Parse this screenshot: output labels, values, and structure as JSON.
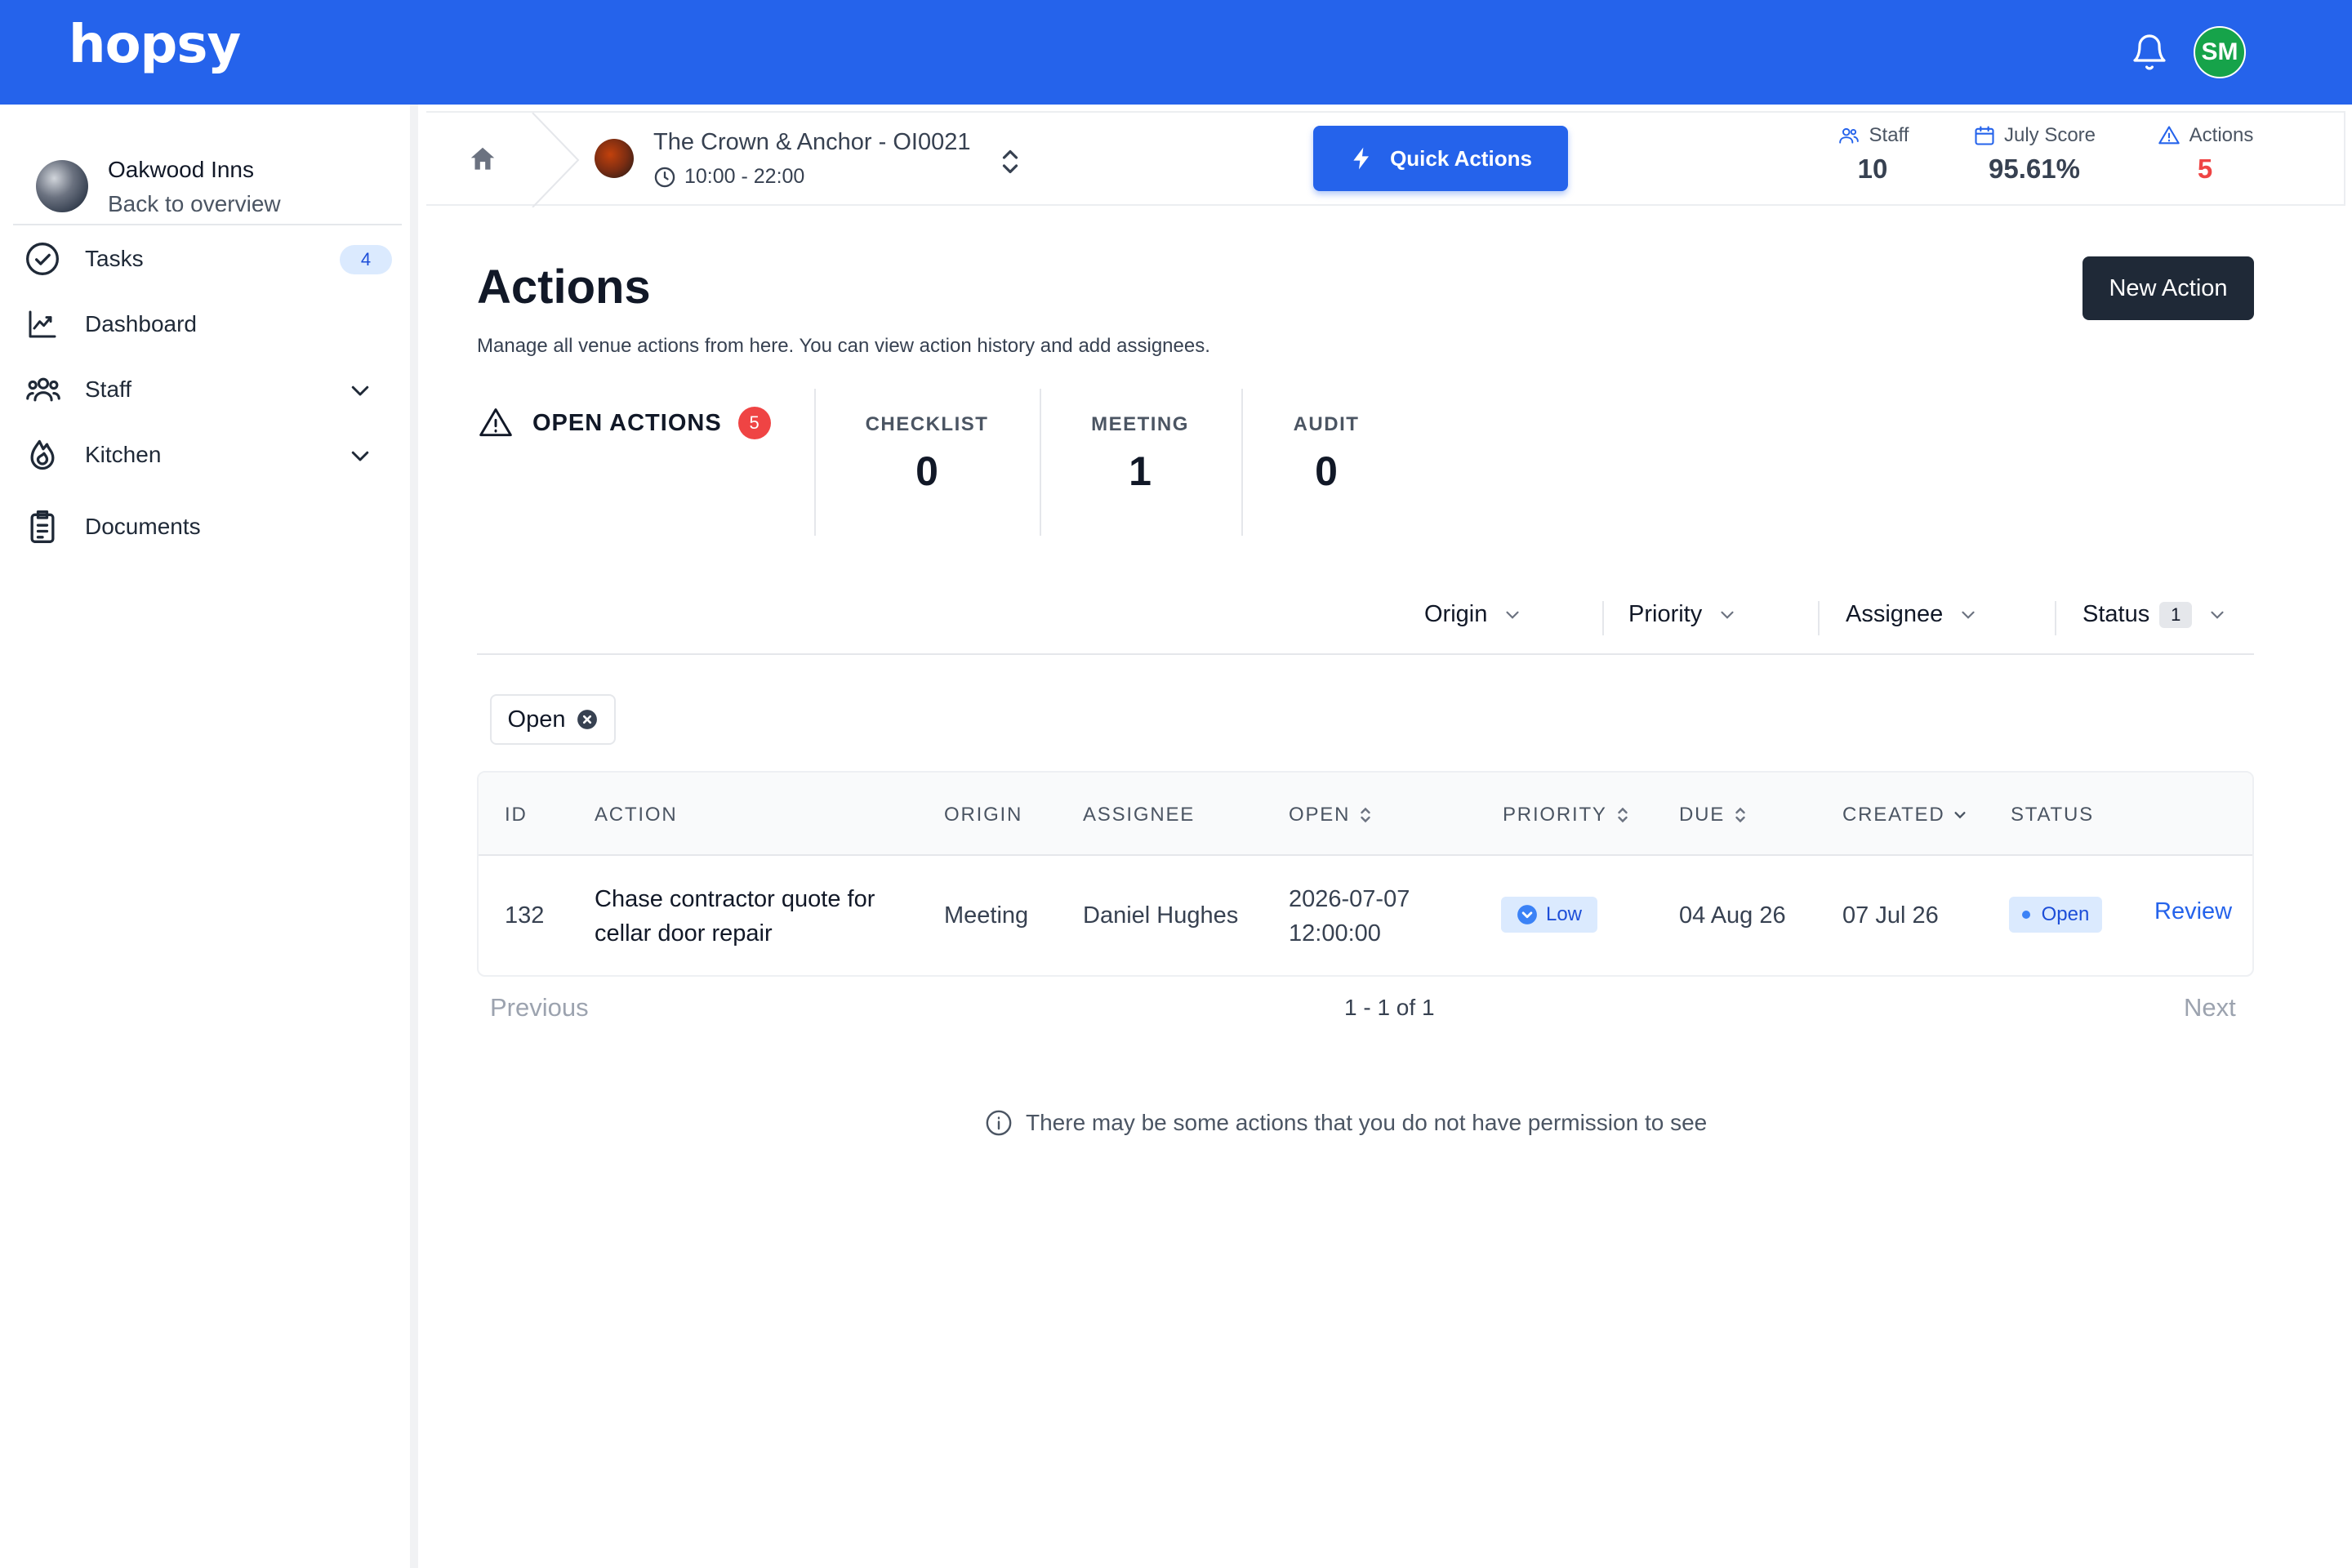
{
  "app": {
    "logo_text": "hopsy",
    "user_initials": "SM"
  },
  "sidebar": {
    "org_name": "Oakwood Inns",
    "org_back": "Back to overview",
    "items": [
      {
        "label": "Tasks",
        "icon": "check-circle-icon",
        "badge": "4"
      },
      {
        "label": "Dashboard",
        "icon": "chart-line-icon"
      },
      {
        "label": "Staff",
        "icon": "users-icon"
      },
      {
        "label": "Kitchen",
        "icon": "fire-icon"
      },
      {
        "label": "Documents",
        "icon": "clipboard-icon"
      }
    ]
  },
  "venue": {
    "name": "The Crown & Anchor - OI0021",
    "hours": "10:00 - 22:00"
  },
  "quick_actions_label": "Quick Actions",
  "stats": [
    {
      "label": "Staff",
      "value": "10",
      "icon": "users-icon"
    },
    {
      "label": "July Score",
      "value": "95.61%",
      "icon": "calendar-icon"
    },
    {
      "label": "Actions",
      "value": "5",
      "icon": "warning-icon",
      "value_color": "#ef4444"
    }
  ],
  "page": {
    "title": "Actions",
    "description": "Manage all venue actions from here. You can view action history and add assignees.",
    "new_action_label": "New Action"
  },
  "summary": {
    "open_actions_label": "OPEN ACTIONS",
    "open_actions_count": "5",
    "counts": [
      {
        "label": "CHECKLIST",
        "value": "0"
      },
      {
        "label": "MEETING",
        "value": "1"
      },
      {
        "label": "AUDIT",
        "value": "0"
      }
    ]
  },
  "filters": {
    "origin": "Origin",
    "priority": "Priority",
    "assignee": "Assignee",
    "status": "Status",
    "status_count": "1",
    "active_chip": "Open"
  },
  "table": {
    "columns": [
      "ID",
      "ACTION",
      "ORIGIN",
      "ASSIGNEE",
      "OPEN",
      "PRIORITY",
      "DUE",
      "CREATED",
      "STATUS"
    ],
    "rows": [
      {
        "id": "132",
        "action_line1": "Chase contractor quote for",
        "action_line2": "cellar door repair",
        "origin": "Meeting",
        "assignee": "Daniel Hughes",
        "open_date": "2026-07-07",
        "open_time": "12:00:00",
        "priority": "Low",
        "due": "04 Aug 26",
        "created": "07 Jul 26",
        "status": "Open",
        "review": "Review"
      }
    ]
  },
  "pagination": {
    "previous": "Previous",
    "info": "1 - 1 of 1",
    "next": "Next"
  },
  "permission_note": "There may be some actions that you do not have permission to see",
  "colors": {
    "brand": "#2563eb",
    "dark_button": "#1f2937",
    "danger": "#ef4444",
    "success": "#16a34a"
  }
}
